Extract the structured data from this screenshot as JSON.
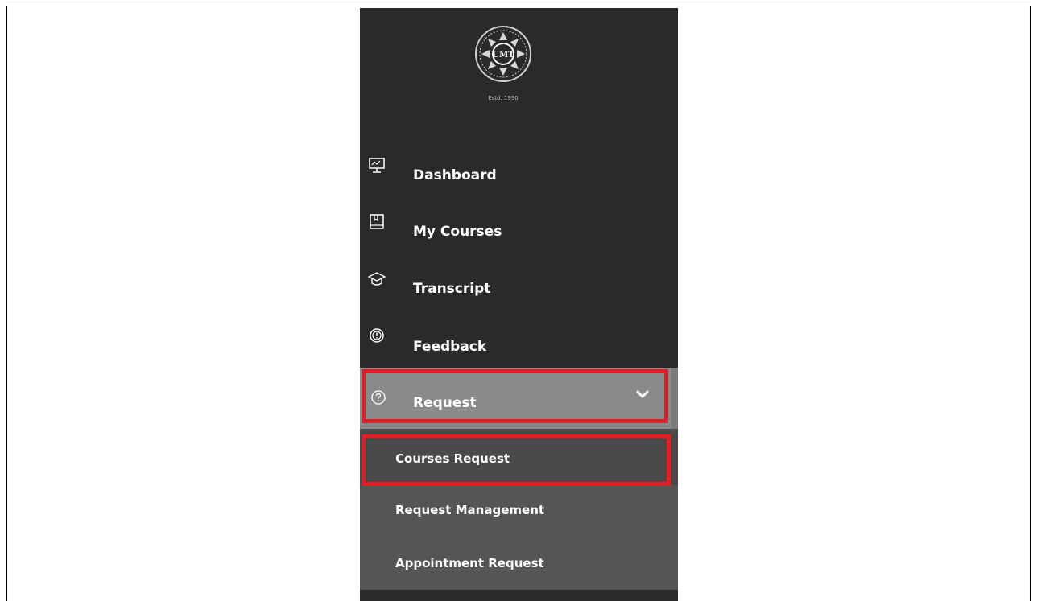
{
  "logo": {
    "emblem_text": "UMT",
    "estd_text": "Estd. 1990"
  },
  "nav": {
    "items": [
      {
        "label": "Dashboard",
        "icon": "presentation-board-icon"
      },
      {
        "label": "My Courses",
        "icon": "book-icon"
      },
      {
        "label": "Transcript",
        "icon": "graduation-cap-icon"
      },
      {
        "label": "Feedback",
        "icon": "feedback-icon"
      },
      {
        "label": "Request",
        "icon": "question-circle-icon",
        "expanded": true
      }
    ],
    "request_submenu": [
      {
        "label": "Courses Request",
        "active": true
      },
      {
        "label": "Request Management"
      },
      {
        "label": "Appointment Request"
      }
    ]
  },
  "colors": {
    "sidebar_bg": "#2a2a2a",
    "active_item_bg": "#8a8a8a",
    "submenu_bg": "#555555",
    "highlight_border": "#e01e25"
  }
}
